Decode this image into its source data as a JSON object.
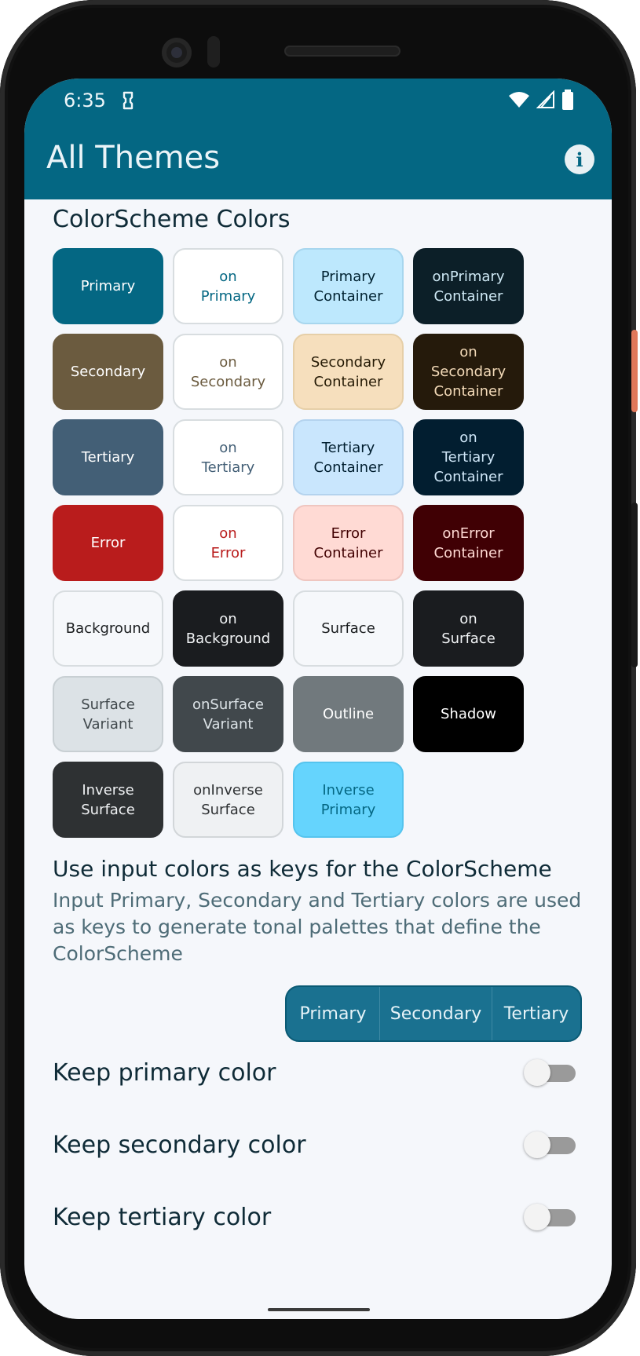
{
  "status_bar": {
    "time": "6:35"
  },
  "app_bar": {
    "title": "All Themes",
    "info_icon": "info-icon"
  },
  "colorscheme": {
    "title": "ColorScheme Colors",
    "swatches": [
      {
        "label": "Primary",
        "bg": "#046783",
        "fg": "#ffffff",
        "border": "#046783"
      },
      {
        "label": "on\nPrimary",
        "bg": "#ffffff",
        "fg": "#046783",
        "border": "#d8dde0"
      },
      {
        "label": "Primary\nContainer",
        "bg": "#bde8fd",
        "fg": "#002231",
        "border": "#a7d6ee"
      },
      {
        "label": "onPrimary\nContainer",
        "bg": "#0c1f28",
        "fg": "#cfe9f5",
        "border": "#0c1f28"
      },
      {
        "label": "Secondary",
        "bg": "#6b5b3f",
        "fg": "#ffffff",
        "border": "#6b5b3f"
      },
      {
        "label": "on\nSecondary",
        "bg": "#ffffff",
        "fg": "#6b5b3f",
        "border": "#d8dde0"
      },
      {
        "label": "Secondary\nContainer",
        "bg": "#f6dfbd",
        "fg": "#251a05",
        "border": "#e6cfa8"
      },
      {
        "label": "on\nSecondary\nContainer",
        "bg": "#251a0b",
        "fg": "#f4dbb9",
        "border": "#251a0b"
      },
      {
        "label": "Tertiary",
        "bg": "#435f76",
        "fg": "#ffffff",
        "border": "#435f76"
      },
      {
        "label": "on\nTertiary",
        "bg": "#ffffff",
        "fg": "#435f76",
        "border": "#d8dde0"
      },
      {
        "label": "Tertiary\nContainer",
        "bg": "#c9e6fd",
        "fg": "#001e2f",
        "border": "#b4d3ee"
      },
      {
        "label": "on\nTertiary\nContainer",
        "bg": "#021e30",
        "fg": "#cfe6f7",
        "border": "#021e30"
      },
      {
        "label": "Error",
        "bg": "#b91c1c",
        "fg": "#ffffff",
        "border": "#b91c1c"
      },
      {
        "label": "on\nError",
        "bg": "#ffffff",
        "fg": "#b91c1c",
        "border": "#d8dde0"
      },
      {
        "label": "Error\nContainer",
        "bg": "#ffdad4",
        "fg": "#410001",
        "border": "#efc6c0"
      },
      {
        "label": "onError\nContainer",
        "bg": "#400004",
        "fg": "#ffdad4",
        "border": "#400004"
      },
      {
        "label": "Background",
        "bg": "#f6f8fb",
        "fg": "#191c1e",
        "border": "#d8dde0"
      },
      {
        "label": "on\nBackground",
        "bg": "#1a1c1f",
        "fg": "#f1f3f5",
        "border": "#1a1c1f"
      },
      {
        "label": "Surface",
        "bg": "#f6f8fb",
        "fg": "#191c1e",
        "border": "#d8dde0"
      },
      {
        "label": "on\nSurface",
        "bg": "#1a1c1f",
        "fg": "#f1f3f5",
        "border": "#1a1c1f"
      },
      {
        "label": "Surface\nVariant",
        "bg": "#dce2e6",
        "fg": "#40484c",
        "border": "#c8cfd3"
      },
      {
        "label": "onSurface\nVariant",
        "bg": "#41484c",
        "fg": "#dce3e7",
        "border": "#41484c"
      },
      {
        "label": "Outline",
        "bg": "#71797d",
        "fg": "#ffffff",
        "border": "#71797d"
      },
      {
        "label": "Shadow",
        "bg": "#000000",
        "fg": "#ffffff",
        "border": "#000000"
      },
      {
        "label": "Inverse\nSurface",
        "bg": "#2e3133",
        "fg": "#eff1f3",
        "border": "#2e3133"
      },
      {
        "label": "onInverse\nSurface",
        "bg": "#eff1f3",
        "fg": "#2e3133",
        "border": "#d2d6d9"
      },
      {
        "label": "Inverse\nPrimary",
        "bg": "#65d4fd",
        "fg": "#046783",
        "border": "#55c4ee"
      }
    ]
  },
  "input_colors": {
    "title": "Use input colors as keys for the ColorScheme",
    "description": "Input Primary, Secondary and Tertiary colors are used as keys to generate tonal palettes that define the ColorScheme",
    "segments": [
      "Primary",
      "Secondary",
      "Tertiary"
    ]
  },
  "toggles": [
    {
      "label": "Keep primary color",
      "on": false
    },
    {
      "label": "Keep secondary color",
      "on": false
    },
    {
      "label": "Keep tertiary color",
      "on": false
    }
  ]
}
